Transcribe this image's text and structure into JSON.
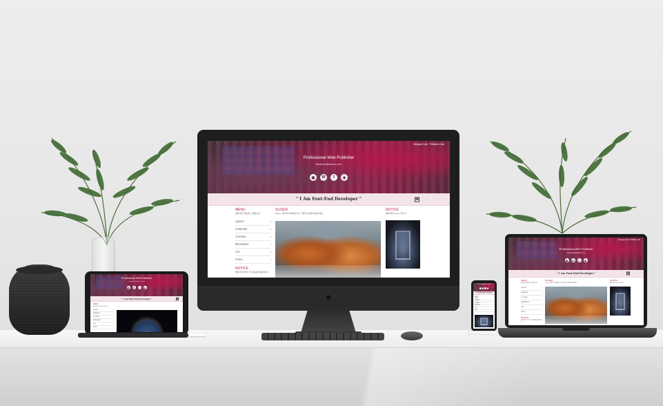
{
  "site": {
    "header_links": [
      "Designer Lab",
      "Publisher Lab"
    ],
    "hero_title": "Professional Web Publisher",
    "hero_subtitle": "hanaholic@dahoon.com",
    "social_icons": [
      {
        "name": "github-icon",
        "glyph": "◉"
      },
      {
        "name": "wordpress-icon",
        "glyph": "W"
      },
      {
        "name": "tumblr-icon",
        "glyph": "t"
      },
      {
        "name": "codepen-icon",
        "glyph": "◈"
      }
    ],
    "banner_title": "\" I Am Font-End Developer \"",
    "banner_button_glyph": "▣",
    "menu": {
      "title": "MENU",
      "desc": "웹에 대한 메뉴를 소개합니다.",
      "items": [
        "JQUERY",
        "STANDARD",
        "TUTORIAL",
        "REFERENCE",
        "CSS",
        "HTML5"
      ]
    },
    "notice_left": {
      "title": "NOTICE",
      "desc": "웹에 대한 여러 가지 정보를 제공합니다."
    },
    "slider": {
      "title": "SLIDER",
      "desc": "jQuery 슬라이더 예제입니다. 다양한 효과를 확인하세요."
    },
    "notice_right": {
      "title": "NOTICE",
      "desc": "웹에 대한 notice 입니다."
    },
    "accent_color": "#c2185b"
  }
}
